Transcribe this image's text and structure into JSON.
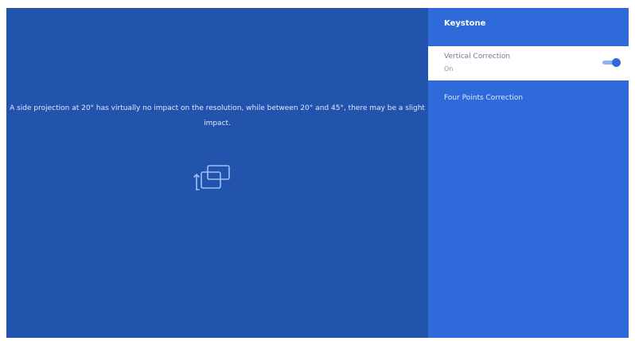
{
  "info": {
    "description": "A side projection at 20° has virtually no impact on the resolution, while between 20° and 45°, there may be a slight impact.",
    "icon": "keystone-icon"
  },
  "menu": {
    "title": "Keystone",
    "items": [
      {
        "label": "Vertical Correction",
        "value": "On",
        "selected": true,
        "toggle": true
      },
      {
        "label": "Four Points Correction",
        "selected": false
      }
    ]
  },
  "colors": {
    "info_background": "#2254ad",
    "menu_background": "#2f6adb",
    "selected_background": "#ffffff",
    "toggle_accent": "#2f6adb"
  }
}
